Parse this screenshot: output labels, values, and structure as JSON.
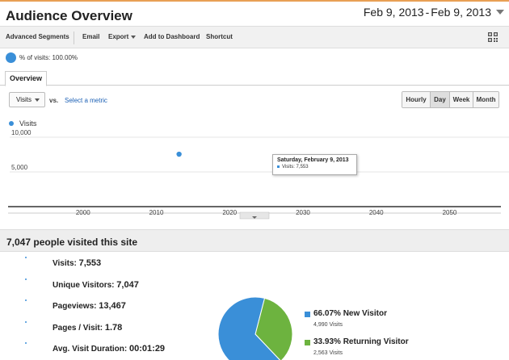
{
  "header": {
    "title": "Audience Overview",
    "date_start": "Feb 9, 2013",
    "date_sep": "-",
    "date_end": "Feb 9, 2013"
  },
  "toolbar": {
    "advanced_segments": "Advanced Segments",
    "email": "Email",
    "export": "Export",
    "add_to_dashboard": "Add to Dashboard",
    "shortcut": "Shortcut"
  },
  "segment": {
    "label": "% of visits: 100.00%"
  },
  "tabs": [
    {
      "label": "Overview"
    }
  ],
  "metric_bar": {
    "selected_metric": "Visits",
    "vs": "vs.",
    "select_metric": "Select a metric",
    "granularity": [
      "Hourly",
      "Day",
      "Week",
      "Month"
    ],
    "active_granularity": "Day"
  },
  "chart_data": {
    "type": "scatter",
    "series": [
      {
        "name": "Visits",
        "x": [
          2013.1
        ],
        "y": [
          7553
        ]
      }
    ],
    "x_ticks": [
      "2000",
      "2010",
      "2020",
      "2030",
      "2040",
      "2050"
    ],
    "y_ticks": [
      "10,000",
      "5,000"
    ],
    "xlim": [
      1990,
      2057
    ],
    "ylim": [
      0,
      10000
    ],
    "grid": true,
    "color": "#3a8fd8"
  },
  "tooltip": {
    "title": "Saturday, February 9, 2013",
    "value": "Visits: 7,553"
  },
  "summary": {
    "title": "7,047 people visited this site",
    "stats": [
      {
        "label": "Visits:",
        "value": "7,553"
      },
      {
        "label": "Unique Visitors:",
        "value": "7,047"
      },
      {
        "label": "Pageviews:",
        "value": "13,467"
      },
      {
        "label": "Pages / Visit:",
        "value": "1.78"
      },
      {
        "label": "Avg. Visit Duration:",
        "value": "00:01:29"
      }
    ]
  },
  "pie": {
    "segments": [
      {
        "percent_label": "66.07%",
        "name": "New Visitor",
        "count": "4,990 Visits",
        "fraction": 0.6607,
        "color": "#3a8fd8"
      },
      {
        "percent_label": "33.93%",
        "name": "Returning Visitor",
        "count": "2,563 Visits",
        "fraction": 0.3393,
        "color": "#6db33f"
      }
    ]
  },
  "colors": {
    "accent": "#3a8fd8",
    "secondary": "#6db33f",
    "top_line": "#e8a055"
  }
}
